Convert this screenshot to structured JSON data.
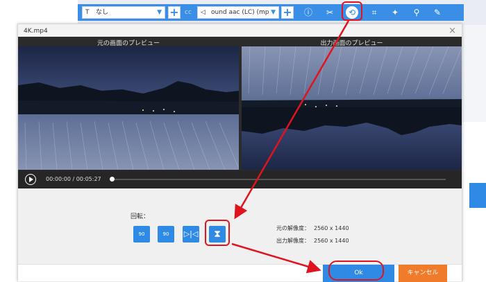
{
  "toolbar": {
    "subtitle_value": "なし",
    "audio_value": "ound aac (LC) (mp",
    "cc_label": "cc",
    "icons": [
      "info-icon",
      "cut-icon",
      "rotate-icon",
      "crop-icon",
      "effect-icon",
      "watermark-icon",
      "edit-icon"
    ]
  },
  "dialog": {
    "title": "4K.mp4",
    "close": "×",
    "original_label": "元の画面のプレビュー",
    "output_label": "出力画面のプレビュー",
    "time": "00:00:00 / 00:05:27",
    "progress": 0,
    "rotate_label": "回転：",
    "rotate_left_label": "90",
    "rotate_right_label": "90",
    "original_resolution_label": "元の解像度：",
    "original_resolution_value": "2560 x 1440",
    "output_resolution_label": "出力解像度：",
    "output_resolution_value": "2560 x 1440",
    "ok_label": "Ok",
    "cancel_label": "キャンセル"
  },
  "colors": {
    "accent": "#2f8ae6",
    "cancel": "#f07b2a",
    "callout": "#e0141e"
  }
}
